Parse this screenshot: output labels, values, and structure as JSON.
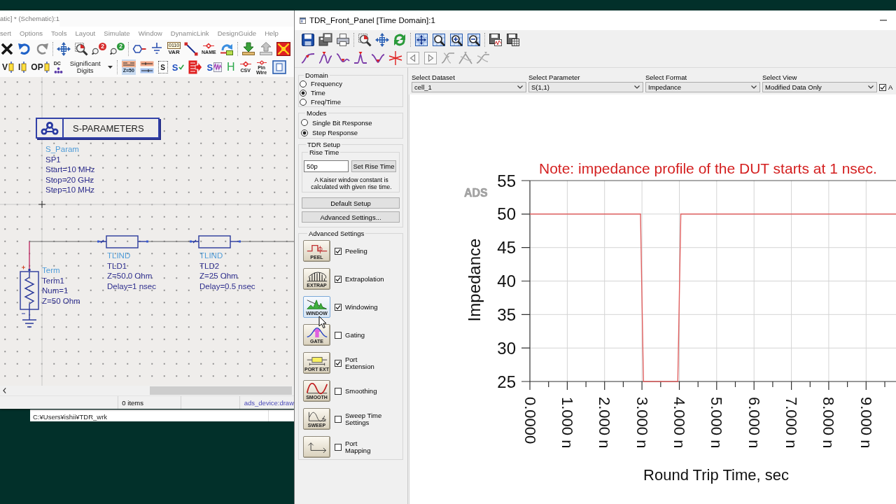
{
  "schematic_window": {
    "title": "atic] * (Schematic):1",
    "menu": [
      "sert",
      "Options",
      "Tools",
      "Layout",
      "Simulate",
      "Window",
      "DynamicLink",
      "DesignGuide",
      "Help"
    ],
    "toolbar_1": [
      {
        "kind": "delete"
      },
      {
        "kind": "undo"
      },
      {
        "kind": "redo"
      },
      {
        "kind": "sep"
      },
      {
        "kind": "move"
      },
      {
        "kind": "zoomarea"
      },
      {
        "kind": "zoomin",
        "label": "2"
      },
      {
        "kind": "zoomout",
        "label": "2"
      },
      {
        "kind": "sep"
      },
      {
        "kind": "port"
      },
      {
        "kind": "ground"
      },
      {
        "kind": "var",
        "chip": "0110",
        "label": "VAR"
      },
      {
        "kind": "wire"
      },
      {
        "kind": "name",
        "label": "NAME"
      },
      {
        "kind": "pin"
      },
      {
        "kind": "sep"
      },
      {
        "kind": "download"
      },
      {
        "kind": "upload"
      },
      {
        "kind": "redx"
      }
    ],
    "toolbar_2": [
      {
        "kind": "vprobe",
        "label": "V"
      },
      {
        "kind": "iprobe",
        "label": "I"
      },
      {
        "kind": "opprobe",
        "label": "OP"
      },
      {
        "kind": "dc",
        "label": "DC"
      },
      {
        "kind": "digits",
        "label": "Significant Digits"
      },
      {
        "kind": "sep"
      },
      {
        "kind": "z50",
        "label": "Z=50"
      },
      {
        "kind": "tline"
      },
      {
        "kind": "sbox",
        "label": "S"
      },
      {
        "kind": "scheck",
        "label": "S"
      },
      {
        "kind": "arrow"
      },
      {
        "kind": "swave",
        "label": "S"
      },
      {
        "kind": "h",
        "label": "H"
      },
      {
        "kind": "csv",
        "label": "CSV"
      },
      {
        "kind": "pinwire",
        "label": "Pin Wire"
      },
      {
        "kind": "frame"
      }
    ],
    "canvas": {
      "simulation_block": {
        "title": "S-PARAMETERS",
        "type": "S_Param",
        "name": "SP1",
        "params": [
          "Start=10 MHz",
          "Stop=20 GHz",
          "Step=10 MHz"
        ]
      },
      "components": [
        {
          "kind": "term",
          "type": "Term",
          "name": "Term1",
          "params": [
            "Num=1",
            "Z=50 Ohm"
          ]
        },
        {
          "kind": "tline",
          "type": "TLIND",
          "name": "TLD1",
          "params": [
            "Z=50.0 Ohm",
            "Delay=1 nsec"
          ]
        },
        {
          "kind": "tline",
          "type": "TLIND",
          "name": "TLD2",
          "params": [
            "Z=25 Ohm",
            "Delay=0.5 nsec"
          ]
        }
      ]
    },
    "status_bar": {
      "item_count": "0 items",
      "library": "ads_device:draw"
    }
  },
  "path_bar": {
    "path": "C:¥Users¥ishii¥TDR_wrk"
  },
  "tdr_window": {
    "title": "TDR_Front_Panel [Time Domain]:1",
    "toolbar_1": [
      {
        "kind": "save"
      },
      {
        "kind": "saveall"
      },
      {
        "kind": "print"
      },
      {
        "kind": "sep"
      },
      {
        "kind": "zoomred"
      },
      {
        "kind": "pan"
      },
      {
        "kind": "refresh"
      },
      {
        "kind": "sep"
      },
      {
        "kind": "fit"
      },
      {
        "kind": "zoombox"
      },
      {
        "kind": "zoomplus"
      },
      {
        "kind": "zoomminus"
      },
      {
        "kind": "sep"
      },
      {
        "kind": "import"
      },
      {
        "kind": "export"
      }
    ],
    "toolbar_2": [
      {
        "kind": "mk1"
      },
      {
        "kind": "mk2"
      },
      {
        "kind": "mk3"
      },
      {
        "kind": "mk4"
      },
      {
        "kind": "mk5"
      },
      {
        "kind": "cross"
      },
      {
        "kind": "left"
      },
      {
        "kind": "right"
      },
      {
        "kind": "gk1"
      },
      {
        "kind": "gk2"
      },
      {
        "kind": "gk3"
      }
    ],
    "domain": {
      "label": "Domain",
      "options": [
        {
          "label": "Frequency",
          "selected": false
        },
        {
          "label": "Time",
          "selected": true
        },
        {
          "label": "Freq/Time",
          "selected": false
        }
      ]
    },
    "modes": {
      "label": "Modes",
      "options": [
        {
          "label": "Single Bit Response",
          "selected": false
        },
        {
          "label": "Step Response",
          "selected": true
        }
      ]
    },
    "tdr_setup": {
      "label": "TDR Setup",
      "rise_time": {
        "label": "Rise Time",
        "value": "50p",
        "button": "Set Rise Time",
        "note": "A Kaiser window constant is calculated with given rise time."
      },
      "buttons": [
        "Default Setup",
        "Advanced Settings..."
      ]
    },
    "advanced_settings": {
      "label": "Advanced Settings",
      "items": [
        {
          "kind": "peel",
          "caption": "PEEL",
          "label": "Peeling",
          "checked": true,
          "hovered": false
        },
        {
          "kind": "extrap",
          "caption": "EXTRAP",
          "label": "Extrapolation",
          "checked": true,
          "hovered": false
        },
        {
          "kind": "window",
          "caption": "WINDOW",
          "label": "Windowing",
          "checked": true,
          "hovered": true
        },
        {
          "kind": "gate",
          "caption": "GATE",
          "label": "Gating",
          "checked": false,
          "hovered": false
        },
        {
          "kind": "portext",
          "caption": "PORT EXT",
          "label": "Port Extension",
          "checked": true,
          "hovered": false
        },
        {
          "kind": "smooth",
          "caption": "SMOOTH",
          "label": "Smoothing",
          "checked": false,
          "hovered": false
        },
        {
          "kind": "sweep",
          "caption": "SWEEP",
          "label": "Sweep Time Settings",
          "checked": false,
          "hovered": false
        },
        {
          "kind": "portmap",
          "label": "Port Mapping",
          "checked": false,
          "hovered": false
        }
      ]
    },
    "selectors": [
      {
        "label": "Select Dataset",
        "value": "cell_1"
      },
      {
        "label": "Select Parameter",
        "value": "S(1,1)"
      },
      {
        "label": "Select Format",
        "value": "Impedance"
      },
      {
        "label": "Select View",
        "value": "Modified Data Only"
      }
    ],
    "view_option": {
      "label": "A",
      "checked": true
    },
    "plot": {
      "logo": "ADS",
      "chart_data": {
        "type": "line",
        "title": "Note: impedance profile of the DUT starts at 1 nsec.",
        "xlabel": "Round Trip Time, sec",
        "ylabel": "Impedance",
        "x": [
          0,
          2.96,
          3.04,
          3.96,
          4.04,
          9.8
        ],
        "series": [
          {
            "color": "#e06060",
            "values": [
              50,
              50,
              25,
              25,
              50,
              50
            ]
          }
        ],
        "xlim": [
          0,
          9.8
        ],
        "ylim": [
          25,
          55
        ],
        "xticks": [
          {
            "value": 0,
            "label": "0.0000"
          },
          {
            "value": 1,
            "label": "1.000 n"
          },
          {
            "value": 2,
            "label": "2.000 n"
          },
          {
            "value": 3,
            "label": "3.000 n"
          },
          {
            "value": 4,
            "label": "4.000 n"
          },
          {
            "value": 5,
            "label": "5.000 n"
          },
          {
            "value": 6,
            "label": "6.000 n"
          },
          {
            "value": 7,
            "label": "7.000 n"
          },
          {
            "value": 8,
            "label": "8.000 n"
          },
          {
            "value": 9,
            "label": "9.000 n"
          }
        ],
        "yticks": [
          25,
          30,
          35,
          40,
          45,
          50,
          55
        ],
        "grid": true
      }
    }
  }
}
